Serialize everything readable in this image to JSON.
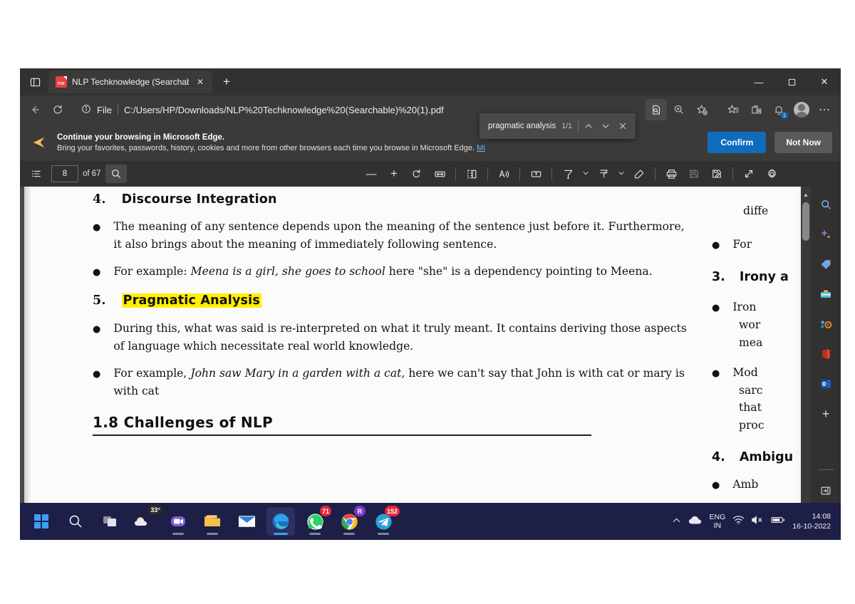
{
  "browser": {
    "tab": {
      "title": "NLP Techknowledge (Searchable",
      "favicon_label": "PDF",
      "close_label": "✕"
    },
    "new_tab_label": "+",
    "window_controls": {
      "minimize": "—",
      "maximize": "☐",
      "close": "✕"
    },
    "nav": {
      "back": "←",
      "refresh": "↻"
    },
    "omnibox": {
      "info_icon_label": "ⓘ",
      "scheme_label": "File",
      "url": "C:/Users/HP/Downloads/NLP%20Techknowledge%20(Searchable)%20(1).pdf"
    },
    "toolbar_icons": [
      {
        "name": "read-aloud-icon"
      },
      {
        "name": "zoom-icon"
      },
      {
        "name": "add-favorite-icon"
      },
      {
        "name": "favorites-icon"
      },
      {
        "name": "collections-icon"
      },
      {
        "name": "notifications-icon",
        "badge": "1"
      },
      {
        "name": "profile-icon"
      },
      {
        "name": "settings-more-icon",
        "label": "⋯"
      }
    ]
  },
  "notification": {
    "title": "Continue your browsing in Microsoft Edge.",
    "subtitle": "Bring your favorites, passwords, history, cookies and more from other browsers each time you browse in Microsoft Edge.",
    "link_text": "Mi",
    "confirm_label": "Confirm",
    "not_now_label": "Not Now"
  },
  "find_bar": {
    "query": "pragmatic analysis",
    "count": "1/1",
    "prev_label": "⌃",
    "next_label": "⌄",
    "close_label": "✕"
  },
  "pdf_toolbar": {
    "page_value": "8",
    "page_total": "of 67",
    "zoom_out_label": "—",
    "zoom_in_label": "+",
    "icons": [
      {
        "name": "table-of-contents-icon"
      },
      {
        "name": "search-icon"
      },
      {
        "name": "rotate-icon"
      },
      {
        "name": "fit-to-width-icon"
      },
      {
        "name": "page-view-icon"
      },
      {
        "name": "read-aloud-icon"
      },
      {
        "name": "add-text-icon"
      },
      {
        "name": "draw-icon"
      },
      {
        "name": "highlight-icon"
      },
      {
        "name": "erase-icon"
      },
      {
        "name": "print-icon"
      },
      {
        "name": "save-icon"
      },
      {
        "name": "save-as-icon"
      },
      {
        "name": "fullscreen-icon"
      },
      {
        "name": "more-settings-icon"
      }
    ]
  },
  "document": {
    "left_column": {
      "section_4": {
        "number": "4.",
        "title": "Discourse Integration",
        "bullets": [
          "The meaning of any sentence depends upon the meaning of the sentence just before it. Furthermore, it also brings about the meaning of immediately following sentence.",
          "For example: Meena is a girl, she goes to school here \"she\" is a dependency pointing to Meena."
        ],
        "bullet_2_italic": "Meena is a girl, she goes to school"
      },
      "section_5": {
        "number": "5.",
        "title": "Pragmatic Analysis",
        "highlighted": true,
        "bullets": [
          "During this, what was said is re-interpreted on what it truly meant. It contains deriving those aspects of language which necessitate real world knowledge.",
          "For example, John saw Mary in a garden with a cat, here we can't say that John is with cat or mary is with cat"
        ],
        "bullet_2_italic": "John saw Mary in a garden with a cat,"
      },
      "chapter_heading": "1.8  Challenges of NLP"
    },
    "right_column": {
      "lines": [
        "diffe",
        "For",
        "Irony a",
        "Iron",
        "wor",
        "mea",
        "Mod",
        "sarc",
        "that",
        "proc",
        "Ambigu",
        "Amb"
      ],
      "heading_3_number": "3.",
      "heading_3_text": "Irony a",
      "heading_4_number": "4.",
      "heading_4_text": "Ambigu"
    },
    "highlight_color": "#ffef00"
  },
  "edge_sidebar": {
    "items": [
      {
        "name": "search-icon",
        "glyph": "🔍"
      },
      {
        "name": "copilot-icon",
        "glyph": "✦"
      },
      {
        "name": "shopping-tag-icon",
        "glyph": "🏷"
      },
      {
        "name": "tools-icon",
        "glyph": "🧰"
      },
      {
        "name": "games-icon",
        "glyph": "♟"
      },
      {
        "name": "office-icon",
        "glyph": "◢"
      },
      {
        "name": "outlook-icon",
        "glyph": "O"
      },
      {
        "name": "add-sidebar-app-icon",
        "glyph": "+"
      },
      {
        "name": "customize-sidebar-icon",
        "glyph": "➦"
      },
      {
        "name": "sidebar-settings-icon",
        "glyph": "⚙"
      }
    ]
  },
  "taskbar": {
    "items": [
      {
        "name": "start-button",
        "glyph": "start"
      },
      {
        "name": "search-button",
        "glyph": "search"
      },
      {
        "name": "task-view-button",
        "glyph": "taskview"
      },
      {
        "name": "weather-widget",
        "glyph": "weather",
        "badge": "33°"
      },
      {
        "name": "zoom-app",
        "glyph": "zoom"
      },
      {
        "name": "file-explorer",
        "glyph": "folder"
      },
      {
        "name": "mail-app",
        "glyph": "mail"
      },
      {
        "name": "microsoft-edge",
        "glyph": "edge",
        "active": true
      },
      {
        "name": "whatsapp",
        "glyph": "whatsapp",
        "badge": "71"
      },
      {
        "name": "google-chrome",
        "glyph": "chrome",
        "badge": "R"
      },
      {
        "name": "telegram",
        "glyph": "telegram",
        "badge": "152"
      }
    ],
    "tray": {
      "show_hidden_label": "⌃",
      "cloud_icon": "cloud-icon",
      "language_line1": "ENG",
      "language_line2": "IN",
      "wifi_icon": "wifi-icon",
      "volume_icon": "volume-muted-icon",
      "battery_icon": "battery-icon",
      "time": "14:08",
      "date": "16-10-2022"
    }
  }
}
